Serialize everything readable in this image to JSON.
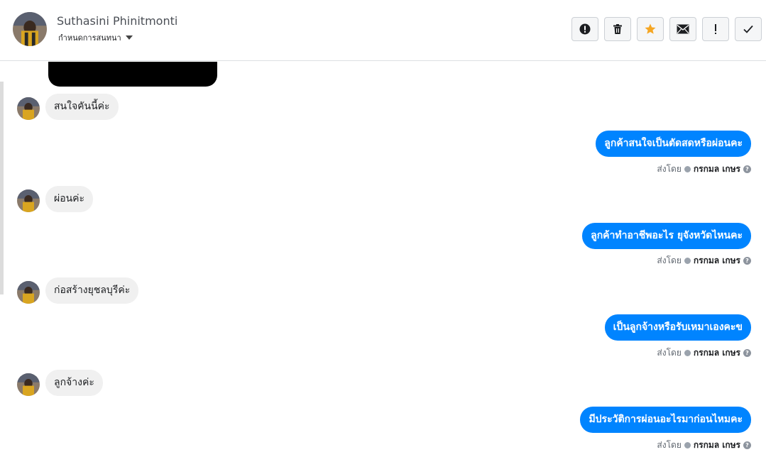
{
  "header": {
    "contact_name": "Suthasini Phinitmonti",
    "assign_label": "กำหนดการสนทนา"
  },
  "toolbar": {
    "buttons": [
      {
        "name": "spam-button",
        "icon": "exclamation-circle-icon",
        "glyph": "!"
      },
      {
        "name": "delete-button",
        "icon": "trash-icon",
        "glyph": "🗑"
      },
      {
        "name": "star-button",
        "icon": "star-icon",
        "glyph": "★",
        "color": "#f5a623"
      },
      {
        "name": "mark-unread-button",
        "icon": "envelope-icon",
        "glyph": "✉"
      },
      {
        "name": "follow-up-button",
        "icon": "exclamation-icon",
        "glyph": "!"
      },
      {
        "name": "mark-done-button",
        "icon": "check-icon",
        "glyph": "✓"
      }
    ]
  },
  "colors": {
    "outgoing_bubble": "#0084ff",
    "incoming_bubble": "#f0f0f0",
    "star": "#f5a623"
  },
  "messages": [
    {
      "direction": "in",
      "text": "สนใจคันนี้ค่ะ"
    },
    {
      "direction": "out",
      "text": "ลูกค้าสนใจเป็นตัดสดหรือผ่อนคะ",
      "sent_by_label": "ส่งโดย",
      "agent": "กรกมล เกษร"
    },
    {
      "direction": "in",
      "text": "ผ่อนค่ะ"
    },
    {
      "direction": "out",
      "text": "ลูกค้าทำอาชีพอะไร ยุจังหวัดไหนคะ",
      "sent_by_label": "ส่งโดย",
      "agent": "กรกมล เกษร"
    },
    {
      "direction": "in",
      "text": "ก่อสร้างยุชลบุรีค่ะ"
    },
    {
      "direction": "out",
      "text": "เป็นลูกจ้างหรือรับเหมาเองคะข",
      "sent_by_label": "ส่งโดย",
      "agent": "กรกมล เกษร"
    },
    {
      "direction": "in",
      "text": "ลูกจ้างค่ะ"
    },
    {
      "direction": "out",
      "text": "มีประวัติการผ่อนอะไรมาก่อนไหมคะ",
      "sent_by_label": "ส่งโดย",
      "agent": "กรกมล เกษร"
    }
  ]
}
